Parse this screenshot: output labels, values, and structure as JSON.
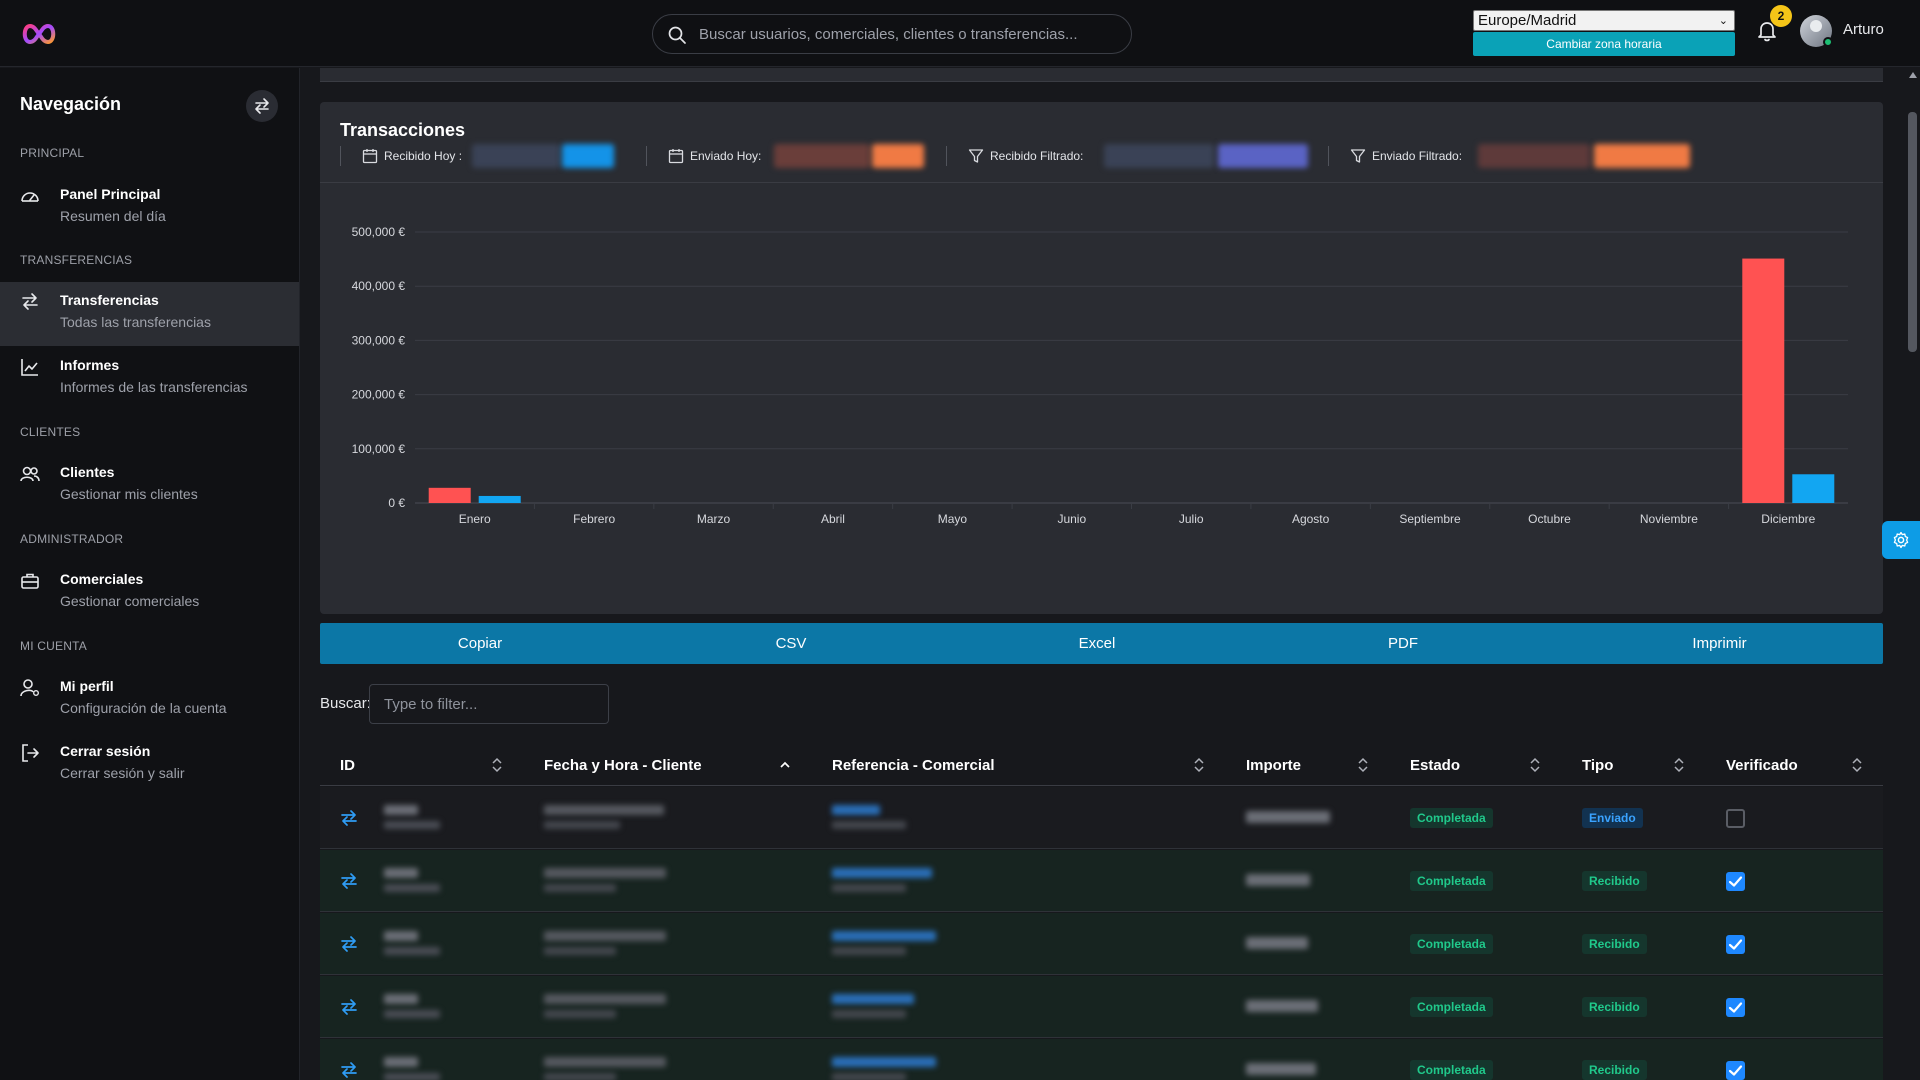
{
  "header": {
    "search_placeholder": "Buscar usuarios, comerciales, clientes o transferencias...",
    "timezone_value": "Europe/Madrid",
    "timezone_button": "Cambiar zona horaria",
    "notifications_count": "2",
    "user_name": "Arturo",
    "brand_color": "#0aa2b7"
  },
  "sidebar": {
    "title": "Navegación",
    "sections": [
      {
        "label": "PRINCIPAL"
      },
      {
        "label": "TRANSFERENCIAS"
      },
      {
        "label": "CLIENTES"
      },
      {
        "label": "ADMINISTRADOR"
      },
      {
        "label": "MI CUENTA"
      }
    ],
    "items": [
      {
        "label": "Panel Principal",
        "sub": "Resumen del día",
        "icon": "dashboard-gauge-icon"
      },
      {
        "label": "Transferencias",
        "sub": "Todas las transferencias",
        "icon": "swap-arrows-icon",
        "active": true
      },
      {
        "label": "Informes",
        "sub": "Informes de las transferencias",
        "icon": "line-chart-icon"
      },
      {
        "label": "Clientes",
        "sub": "Gestionar mis clientes",
        "icon": "users-icon"
      },
      {
        "label": "Comerciales",
        "sub": "Gestionar comerciales",
        "icon": "briefcase-icon"
      },
      {
        "label": "Mi perfil",
        "sub": "Configuración de la cuenta",
        "icon": "user-gear-icon"
      },
      {
        "label": "Cerrar sesión",
        "sub": "Cerrar sesión y salir",
        "icon": "logout-icon"
      }
    ]
  },
  "transactions": {
    "title": "Transacciones",
    "stats": [
      {
        "label": "Recibido Hoy :",
        "icon": "calendar-icon"
      },
      {
        "label": "Enviado Hoy:",
        "icon": "calendar-icon"
      },
      {
        "label": "Recibido Filtrado:",
        "icon": "filter-icon"
      },
      {
        "label": "Enviado Filtrado:",
        "icon": "filter-icon"
      }
    ]
  },
  "chart_data": {
    "type": "bar",
    "categories": [
      "Enero",
      "Febrero",
      "Marzo",
      "Abril",
      "Mayo",
      "Junio",
      "Julio",
      "Agosto",
      "Septiembre",
      "Octubre",
      "Noviembre",
      "Diciembre"
    ],
    "series": [
      {
        "values": [
          28000,
          0,
          0,
          0,
          0,
          0,
          0,
          0,
          0,
          0,
          0,
          451000
        ],
        "color": "#ff5252"
      },
      {
        "values": [
          13000,
          0,
          0,
          0,
          0,
          0,
          0,
          0,
          0,
          0,
          0,
          53000
        ],
        "color": "#12a6f2"
      }
    ],
    "ytick_labels": [
      "0 €",
      "100,000 €",
      "200,000 €",
      "300,000 €",
      "400,000 €",
      "500,000 €"
    ],
    "yticks": [
      0,
      100000,
      200000,
      300000,
      400000,
      500000
    ],
    "ylim": [
      0,
      500000
    ],
    "grid": true
  },
  "export": {
    "buttons": [
      "Copiar",
      "CSV",
      "Excel",
      "PDF",
      "Imprimir"
    ]
  },
  "filter": {
    "label": "Buscar:",
    "placeholder": "Type to filter..."
  },
  "table": {
    "headers": [
      "ID",
      "Fecha y Hora - Cliente",
      "Referencia - Comercial",
      "Importe",
      "Estado",
      "Tipo",
      "Verificado"
    ],
    "rows": [
      {
        "estado": "Completada",
        "tipo": "Enviado",
        "verificado": false
      },
      {
        "estado": "Completada",
        "tipo": "Recibido",
        "verificado": true
      },
      {
        "estado": "Completada",
        "tipo": "Recibido",
        "verificado": true
      },
      {
        "estado": "Completada",
        "tipo": "Recibido",
        "verificado": true
      },
      {
        "estado": "Completada",
        "tipo": "Recibido",
        "verificado": true
      }
    ]
  }
}
